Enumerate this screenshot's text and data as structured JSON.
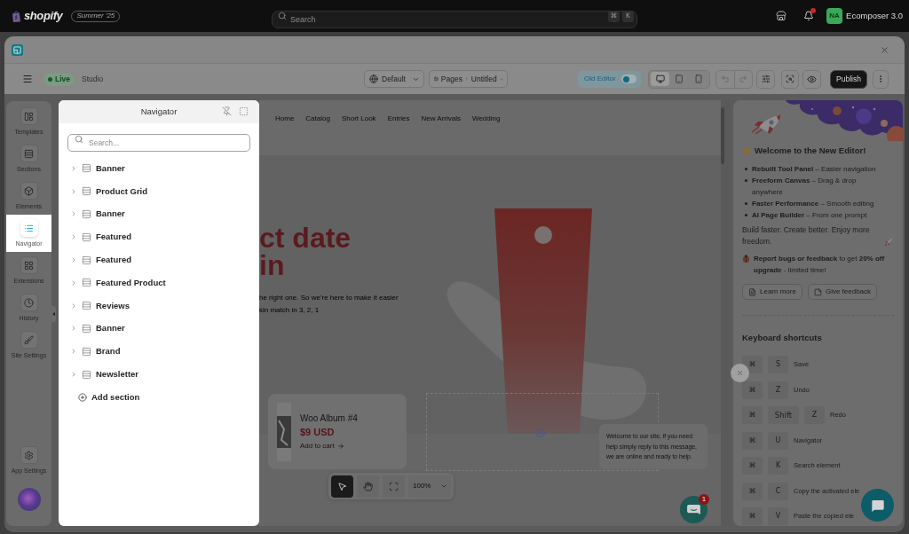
{
  "topbar": {
    "logo": "shopify",
    "badge": "Summer '25",
    "search": {
      "placeholder": "Search",
      "keys": [
        "⌘",
        "K"
      ]
    },
    "account": {
      "initials": "NA",
      "name": "Ecomposer 3.0"
    }
  },
  "toolbar": {
    "status": "Live",
    "mode": "Studio",
    "theme": "Default",
    "breadcrumb": [
      "Pages",
      "Untitled"
    ],
    "old_editor": {
      "label": "Old Editor",
      "on": false
    },
    "devices": [
      {
        "kind": "desktop",
        "selected": true
      },
      {
        "kind": "tablet",
        "selected": false
      },
      {
        "kind": "mobile",
        "selected": false
      }
    ],
    "history": [
      {
        "kind": "undo",
        "disabled": true
      },
      {
        "kind": "redo",
        "disabled": true
      }
    ],
    "publish": "Publish"
  },
  "sidebar": {
    "items": [
      {
        "kind": "templates",
        "label": "Templates",
        "selected": false
      },
      {
        "kind": "sections",
        "label": "Sections",
        "selected": false
      },
      {
        "kind": "elements",
        "label": "Elements",
        "selected": false
      },
      {
        "kind": "navigator",
        "label": "Navigator",
        "selected": true
      },
      {
        "kind": "extensions",
        "label": "Extensions",
        "selected": false
      },
      {
        "kind": "history",
        "label": "History",
        "selected": false
      },
      {
        "kind": "site_settings",
        "label": "Site Settings",
        "selected": false
      }
    ],
    "footer": [
      {
        "kind": "app_settings",
        "label": "App Settings",
        "selected": false
      }
    ]
  },
  "navigator": {
    "title": "Navigator",
    "search": {
      "placeholder": "Search..."
    },
    "sections": [
      {
        "label": "Banner",
        "expanded": false
      },
      {
        "label": "Product Grid",
        "expanded": false
      },
      {
        "label": "Banner",
        "expanded": false
      },
      {
        "label": "Featured",
        "expanded": false
      },
      {
        "label": "Featured",
        "expanded": false
      },
      {
        "label": "Featured Product",
        "expanded": false
      },
      {
        "label": "Reviews",
        "expanded": false
      },
      {
        "label": "Banner",
        "expanded": false
      },
      {
        "label": "Brand",
        "expanded": false
      },
      {
        "label": "Newsletter",
        "expanded": false
      }
    ],
    "add_section": "Add section"
  },
  "canvas": {
    "nav_links": [
      "Home",
      "Catalog",
      "Short Look",
      "Entries",
      "New Arrivals",
      "Wedding"
    ],
    "hero": {
      "heading_lines": [
        "ct date",
        "in"
      ],
      "text_lines": [
        "he right one. So we're here to make it easier",
        "kin match in 3, 2, 1"
      ]
    },
    "product_card": {
      "title": "Woo Album #4",
      "price": "$9 USD",
      "cta": "Add to cart"
    },
    "chat_message": "Welcome to our site, if you need help simply reply to this message, we are online and ready to help.",
    "chat_badge": "1",
    "tools": [
      {
        "kind": "select",
        "selected": true
      },
      {
        "kind": "hand",
        "selected": false
      },
      {
        "kind": "focus",
        "selected": false
      }
    ],
    "zoom": "100%"
  },
  "welcome": {
    "title": "Welcome to the New Editor!",
    "features": [
      "**Rebuilt Tool Panel** – Easier navigation",
      "**Freeform Canvas** – Drag & drop anywhere",
      "**Faster Performance** – Smooth editing",
      "**AI Page Builder** – From one prompt"
    ],
    "tagline": "Build faster. Create better. Enjoy more freedom.",
    "promo": "**Report bugs or feedback** to get **20% off upgrade** - limited time!",
    "buttons": [
      {
        "kind": "learn",
        "label": "Learn more"
      },
      {
        "kind": "feedback",
        "label": "Give feedback"
      }
    ]
  },
  "shortcuts": {
    "title": "Keyboard shortcuts",
    "items": [
      {
        "keys": [
          "⌘",
          "S"
        ],
        "action": "Save"
      },
      {
        "keys": [
          "⌘",
          "Z"
        ],
        "action": "Undo"
      },
      {
        "keys": [
          "⌘",
          "Shift",
          "Z"
        ],
        "action": "Redo"
      },
      {
        "keys": [
          "⌘",
          "U"
        ],
        "action": "Navigator"
      },
      {
        "keys": [
          "⌘",
          "K"
        ],
        "action": "Search element"
      },
      {
        "keys": [
          "⌘",
          "C"
        ],
        "action": "Copy the activated ele"
      },
      {
        "keys": [
          "⌘",
          "V"
        ],
        "action": "Paste the copied ele"
      }
    ]
  }
}
